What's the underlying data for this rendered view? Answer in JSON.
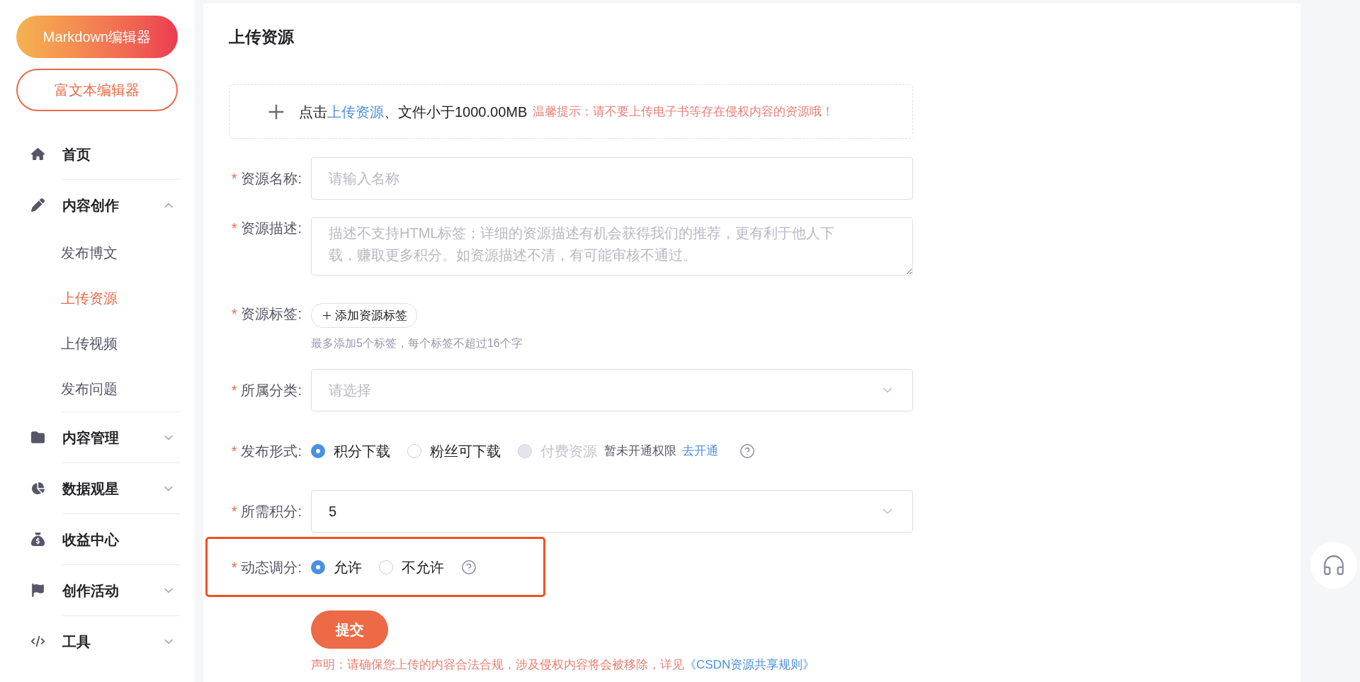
{
  "sidebar": {
    "buttons": [
      {
        "label": "Markdown编辑器",
        "kind": "gradient"
      },
      {
        "label": "富文本编辑器",
        "kind": "outline"
      }
    ],
    "menu": [
      {
        "label": "首页"
      },
      {
        "label": "内容创作",
        "expanded": true,
        "children": [
          {
            "label": "发布博文",
            "selected": false
          },
          {
            "label": "上传资源",
            "selected": true
          },
          {
            "label": "上传视频",
            "selected": false
          },
          {
            "label": "发布问题",
            "selected": false
          }
        ]
      },
      {
        "label": "内容管理",
        "expanded": false
      },
      {
        "label": "数据观星",
        "expanded": false
      },
      {
        "label": "收益中心"
      },
      {
        "label": "创作活动",
        "expanded": false
      },
      {
        "label": "工具",
        "expanded": false
      }
    ]
  },
  "main": {
    "title": "上传资源",
    "upload": {
      "prefix": "点击",
      "link": "上传资源",
      "suffix": "、文件小于1000.00MB",
      "warning": "温馨提示：请不要上传电子书等存在侵权内容的资源哦！"
    },
    "fields": [
      {
        "kind": "text",
        "mark": "*",
        "label": "资源名称:",
        "placeholder": "请输入名称"
      },
      {
        "kind": "textarea",
        "mark": "*",
        "label": "资源描述:",
        "placeholder": "描述不支持HTML标签；详细的资源描述有机会获得我们的推荐，更有利于他人下载，赚取更多积分。如资源描述不清，有可能审核不通过。"
      },
      {
        "kind": "tags",
        "mark": "*",
        "label": "资源标签:",
        "button": "添加资源标签",
        "hint": "最多添加5个标签，每个标签不超过16个字"
      },
      {
        "kind": "select",
        "mark": "*",
        "label": "所属分类:",
        "placeholder": "请选择"
      },
      {
        "kind": "radio",
        "mark": "*",
        "label": "发布形式:",
        "help": true,
        "highlighted": false,
        "options": [
          {
            "label": "积分下载",
            "selected": true,
            "disabled": false
          },
          {
            "label": "粉丝可下载",
            "selected": false,
            "disabled": false
          },
          {
            "label": "付费资源",
            "selected": false,
            "disabled": true,
            "note": "暂未开通权限",
            "link": "去开通"
          }
        ]
      },
      {
        "kind": "select",
        "mark": "*",
        "label": "所需积分:",
        "value": "5"
      },
      {
        "kind": "radio",
        "mark": "*",
        "label": "动态调分:",
        "help": true,
        "highlighted": true,
        "options": [
          {
            "label": "允许",
            "selected": true,
            "disabled": false
          },
          {
            "label": "不允许",
            "selected": false,
            "disabled": false
          }
        ]
      }
    ],
    "submit": "提交",
    "disclaimer": {
      "text": "声明：请确保您上传的内容合法合规，涉及侵权内容将会被移除，详见",
      "link": "《CSDN资源共享规则》"
    }
  }
}
